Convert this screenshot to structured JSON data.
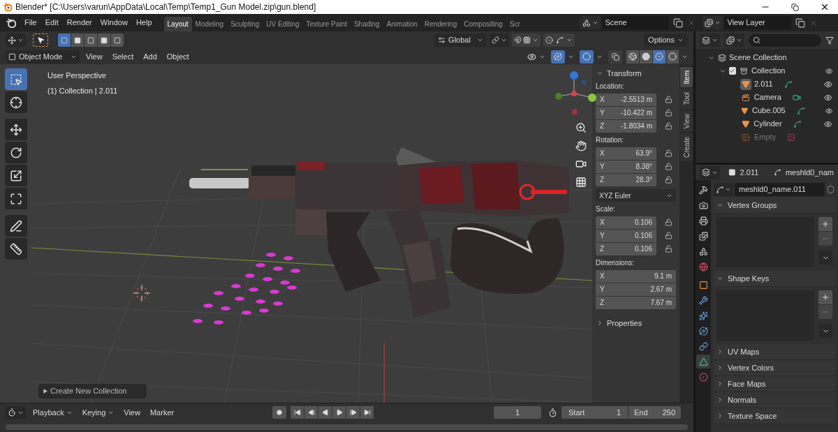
{
  "window": {
    "title": "Blender* [C:\\Users\\varun\\AppData\\Local\\Temp\\Temp1_Gun Model.zip\\gun.blend]"
  },
  "menu": [
    "File",
    "Edit",
    "Render",
    "Window",
    "Help"
  ],
  "workspaces": [
    {
      "label": "Layout",
      "selected": true
    },
    {
      "label": "Modeling",
      "selected": false
    },
    {
      "label": "Sculpting",
      "selected": false
    },
    {
      "label": "UV Editing",
      "selected": false
    },
    {
      "label": "Texture Paint",
      "selected": false
    },
    {
      "label": "Shading",
      "selected": false
    },
    {
      "label": "Animation",
      "selected": false
    },
    {
      "label": "Rendering",
      "selected": false
    },
    {
      "label": "Compositing",
      "selected": false
    },
    {
      "label": "Scr",
      "selected": false
    }
  ],
  "scene": {
    "name": "Scene"
  },
  "view_layer": {
    "name": "View Layer"
  },
  "tool_header": {
    "select_modes": [
      {
        "selected": true
      },
      {
        "selected": false
      },
      {
        "selected": false
      },
      {
        "selected": false
      },
      {
        "selected": false
      }
    ],
    "orientation": "Global",
    "options": "Options"
  },
  "viewport_header": {
    "mode": "Object Mode",
    "menus": [
      "View",
      "Select",
      "Add",
      "Object"
    ],
    "gizmos_on": true,
    "overlays_on": true,
    "shading": [
      {
        "kind": "wireframe",
        "selected": false
      },
      {
        "kind": "solid",
        "selected": false
      },
      {
        "kind": "material",
        "selected": true
      },
      {
        "kind": "rendered",
        "selected": false
      }
    ]
  },
  "viewport": {
    "overlay_lines": [
      "User Perspective",
      "(1) Collection | 2.011"
    ],
    "tools": [
      {
        "kind": "select",
        "selected": true
      },
      {
        "kind": "cursor",
        "selected": false
      },
      {
        "kind": "move",
        "selected": false
      },
      {
        "kind": "rotate",
        "selected": false
      },
      {
        "kind": "scale",
        "selected": false
      },
      {
        "kind": "transform",
        "selected": false
      },
      {
        "kind": "annotate",
        "selected": false
      },
      {
        "kind": "measure",
        "selected": false
      }
    ],
    "operator_panel": {
      "title": "Create New Collection",
      "expanded": false
    }
  },
  "sidebar": {
    "tabs": [
      {
        "label": "Item",
        "selected": true
      },
      {
        "label": "Tool",
        "selected": false
      },
      {
        "label": "View",
        "selected": false
      },
      {
        "label": "Create",
        "selected": false
      }
    ],
    "transform": {
      "title": "Transform",
      "expanded": true,
      "groups": [
        {
          "kind": "vector",
          "label": "Location:",
          "fields": [
            {
              "axis": "X",
              "value": "-2.5513 m",
              "locked": false
            },
            {
              "axis": "Y",
              "value": "-10.422 m",
              "locked": false
            },
            {
              "axis": "Z",
              "value": "-1.8034 m",
              "locked": false
            }
          ]
        },
        {
          "kind": "vector",
          "label": "Rotation:",
          "fields": [
            {
              "axis": "X",
              "value": "63.9°",
              "locked": false
            },
            {
              "axis": "Y",
              "value": "8.38°",
              "locked": false
            },
            {
              "axis": "Z",
              "value": "28.3°",
              "locked": false
            }
          ]
        },
        {
          "kind": "dropdown",
          "value": "XYZ Euler"
        },
        {
          "kind": "vector",
          "label": "Scale:",
          "fields": [
            {
              "axis": "X",
              "value": "0.106",
              "locked": false
            },
            {
              "axis": "Y",
              "value": "0.106",
              "locked": false
            },
            {
              "axis": "Z",
              "value": "0.106",
              "locked": false
            }
          ]
        },
        {
          "kind": "vector",
          "label": "Dimensions:",
          "fields": [
            {
              "axis": "X",
              "value": "9.1 m"
            },
            {
              "axis": "Y",
              "value": "2.67 m"
            },
            {
              "axis": "Z",
              "value": "7.67 m"
            }
          ]
        }
      ]
    },
    "properties_panel": {
      "title": "Properties",
      "expanded": false
    }
  },
  "outliner": {
    "tree": {
      "label": "Scene Collection",
      "children": [
        {
          "label": "Collection",
          "kind": "collection",
          "checked": true,
          "expanded": true,
          "children": [
            {
              "label": "2.011",
              "kind": "mesh",
              "selected": true,
              "visible": true
            },
            {
              "label": "Camera",
              "kind": "camera",
              "selected": false,
              "visible": true
            },
            {
              "label": "Cube.005",
              "kind": "mesh",
              "selected": false,
              "visible": true
            },
            {
              "label": "Cylinder",
              "kind": "mesh",
              "selected": false,
              "visible": true
            },
            {
              "label": "Empty",
              "kind": "image_empty",
              "selected": false,
              "visible": false
            }
          ]
        }
      ]
    }
  },
  "properties": {
    "object": "2.011",
    "data": "meshld0_nam",
    "datablock": "meshld0_name.011",
    "tabs": [
      {
        "kind": "tool",
        "selected": false
      },
      {
        "kind": "render",
        "selected": false
      },
      {
        "kind": "output",
        "selected": false
      },
      {
        "kind": "view_layer",
        "selected": false
      },
      {
        "kind": "scene",
        "selected": false
      },
      {
        "kind": "world",
        "selected": false
      },
      {
        "kind": "object",
        "selected": false
      },
      {
        "kind": "modifiers",
        "selected": false
      },
      {
        "kind": "particles",
        "selected": false
      },
      {
        "kind": "physics",
        "selected": false
      },
      {
        "kind": "constraints",
        "selected": false
      },
      {
        "kind": "data",
        "selected": true
      },
      {
        "kind": "material",
        "selected": false
      }
    ],
    "panels": [
      {
        "title": "Vertex Groups",
        "expanded": true
      },
      {
        "title": "Shape Keys",
        "expanded": true
      },
      {
        "title": "UV Maps",
        "expanded": false
      },
      {
        "title": "Vertex Colors",
        "expanded": false
      },
      {
        "title": "Face Maps",
        "expanded": false
      },
      {
        "title": "Normals",
        "expanded": false
      },
      {
        "title": "Texture Space",
        "expanded": false
      }
    ]
  },
  "timeline": {
    "menus": [
      "Playback",
      "Keying",
      "View",
      "Marker"
    ],
    "current_frame": "1",
    "start": {
      "label": "Start",
      "value": "1"
    },
    "end": {
      "label": "End",
      "value": "250"
    }
  }
}
